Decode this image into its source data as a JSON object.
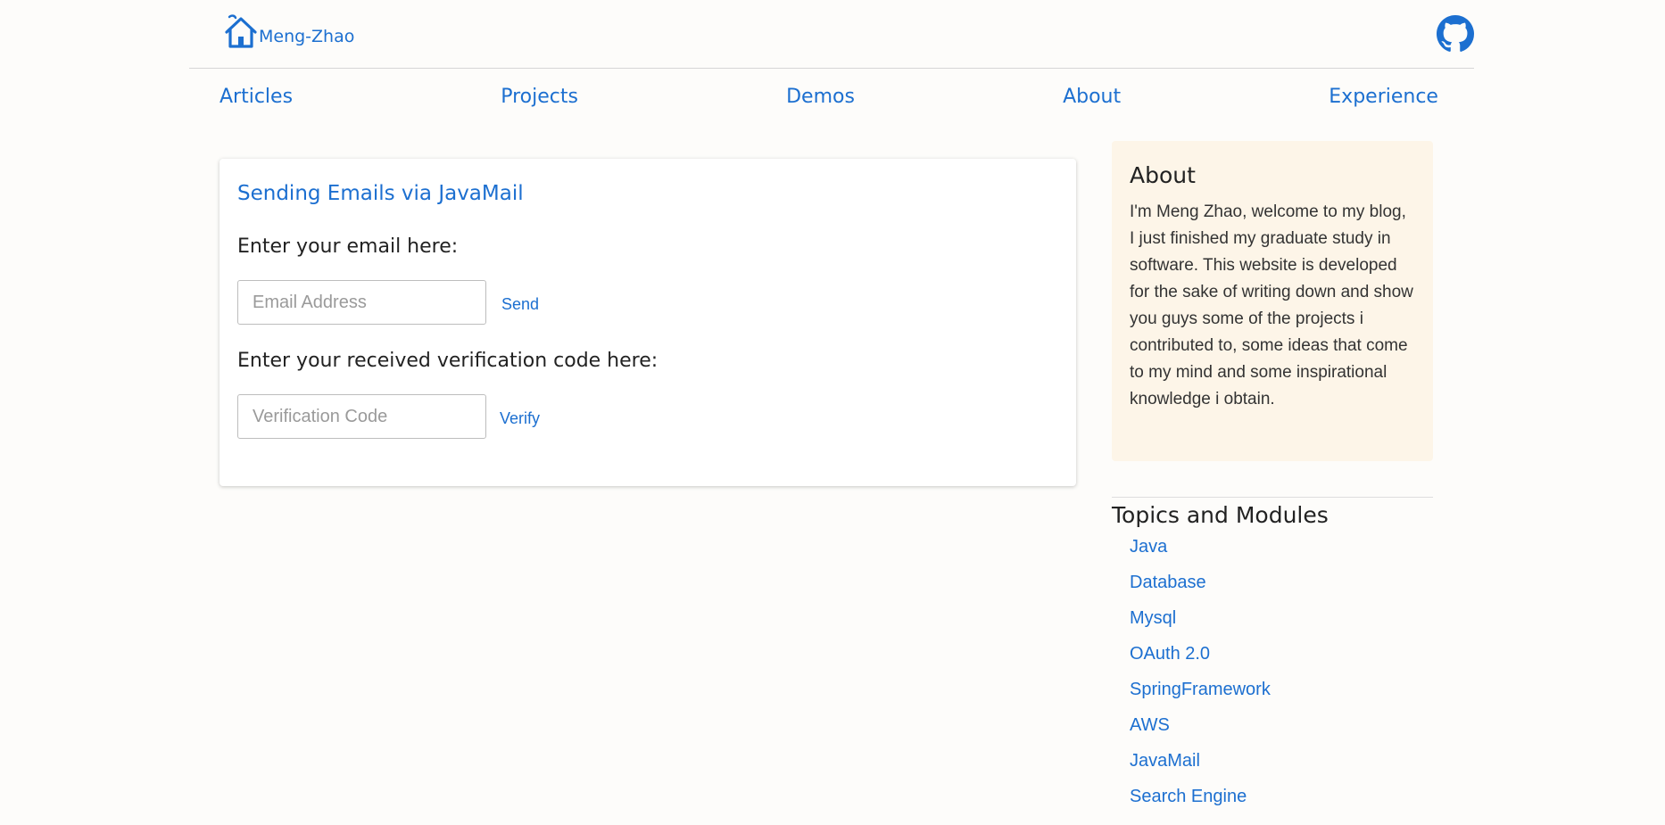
{
  "colors": {
    "accent": "#1c6fd0",
    "page_background": "#fdfcfa",
    "about_background": "#fdf5e8"
  },
  "header": {
    "brand_text": "Meng-Zhao",
    "brand_icon": "home-icon",
    "github_icon": "github-icon"
  },
  "nav": {
    "items": [
      {
        "label": "Articles"
      },
      {
        "label": "Projects"
      },
      {
        "label": "Demos"
      },
      {
        "label": "About"
      },
      {
        "label": "Experience"
      }
    ]
  },
  "main": {
    "title": "Sending Emails via JavaMail",
    "email_label": "Enter your email here:",
    "email_placeholder": "Email Address",
    "email_value": "",
    "send_label": "Send",
    "code_label": "Enter your received verification code here:",
    "code_placeholder": "Verification Code",
    "code_value": "",
    "verify_label": "Verify"
  },
  "sidebar": {
    "about_title": "About",
    "about_text": "I'm Meng Zhao, welcome to my blog, I just finished my graduate study in software. This website is developed for the sake of writing down and show you guys some of the projects i contributed to, some ideas that come to my mind and some inspirational knowledge i obtain.",
    "topics_title": "Topics and Modules",
    "topics": [
      {
        "label": "Java"
      },
      {
        "label": "Database"
      },
      {
        "label": "Mysql"
      },
      {
        "label": "OAuth 2.0"
      },
      {
        "label": "SpringFramework"
      },
      {
        "label": "AWS"
      },
      {
        "label": "JavaMail"
      },
      {
        "label": "Search Engine"
      }
    ]
  }
}
